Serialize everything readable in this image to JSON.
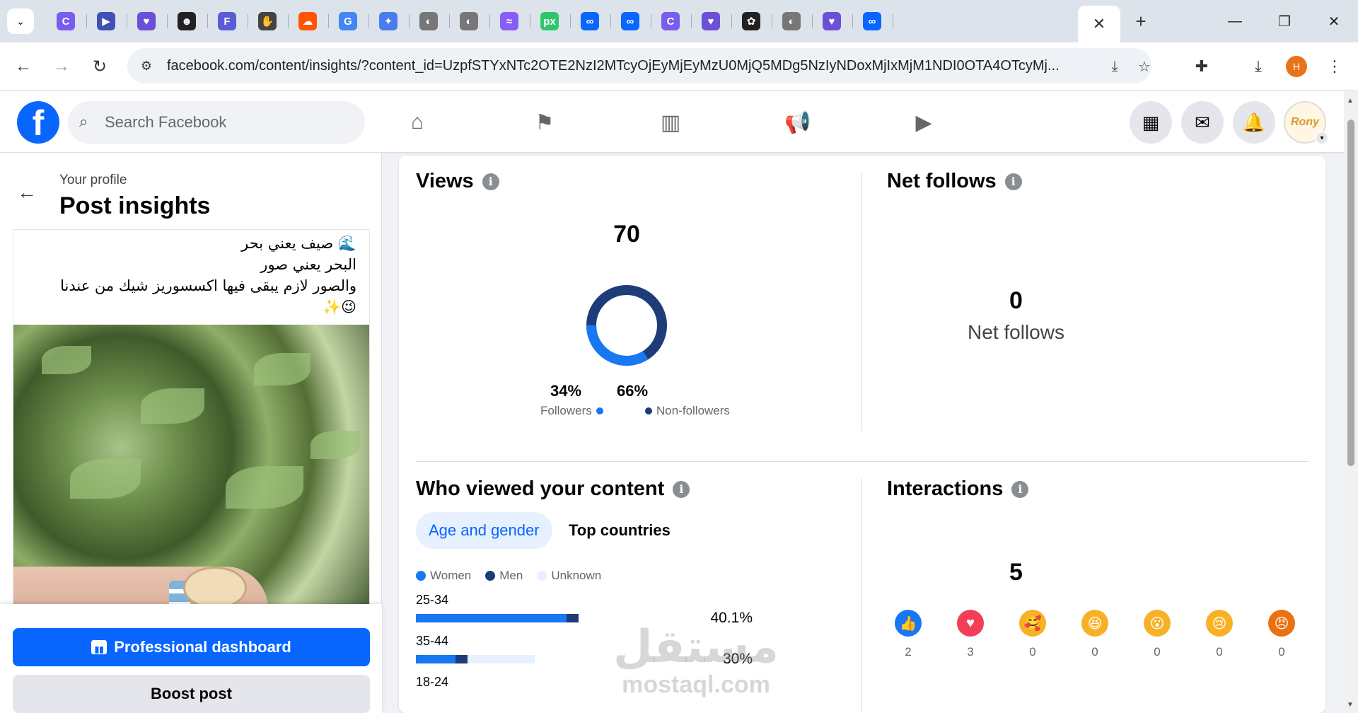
{
  "browser": {
    "tabs": [
      {
        "icon": "copilot-icon",
        "color": "#7a5cf0",
        "glyph": "C"
      },
      {
        "icon": "video-call-icon",
        "color": "#3f51b5",
        "glyph": "▶"
      },
      {
        "icon": "heart-badge-icon",
        "color": "#6b4fd8",
        "glyph": "♥"
      },
      {
        "icon": "robot-icon",
        "color": "#222222",
        "glyph": "☻"
      },
      {
        "icon": "forms-icon",
        "color": "#5b5bd6",
        "glyph": "F"
      },
      {
        "icon": "hand-icon",
        "color": "#444444",
        "glyph": "✋"
      },
      {
        "icon": "soundcloud-icon",
        "color": "#ff5500",
        "glyph": "☁"
      },
      {
        "icon": "google-icon",
        "color": "#4285f4",
        "glyph": "G"
      },
      {
        "icon": "gemini-icon",
        "color": "#4a7cf0",
        "glyph": "✦"
      },
      {
        "icon": "globe-icon",
        "color": "#777777",
        "glyph": "◐"
      },
      {
        "icon": "globe-icon",
        "color": "#777777",
        "glyph": "◐"
      },
      {
        "icon": "stripes-icon",
        "color": "#8a5cf6",
        "glyph": "≈"
      },
      {
        "icon": "pixabay-icon",
        "color": "#2ec66d",
        "glyph": "px"
      },
      {
        "icon": "meta-icon",
        "color": "#0866ff",
        "glyph": "∞"
      },
      {
        "icon": "meta-icon",
        "color": "#0866ff",
        "glyph": "∞"
      },
      {
        "icon": "copilot-icon",
        "color": "#7a5cf0",
        "glyph": "C"
      },
      {
        "icon": "heart-badge-icon",
        "color": "#6b4fd8",
        "glyph": "♥"
      },
      {
        "icon": "chatgpt-icon",
        "color": "#222222",
        "glyph": "✿"
      },
      {
        "icon": "globe-icon",
        "color": "#777777",
        "glyph": "◐"
      },
      {
        "icon": "heart-badge-icon",
        "color": "#6b4fd8",
        "glyph": "♥"
      },
      {
        "icon": "meta-icon",
        "color": "#0866ff",
        "glyph": "∞"
      }
    ],
    "active_tab_close": "✕",
    "new_tab": "+",
    "url": "facebook.com/content/insights/?content_id=UzpfSTYxNTc2OTE2NzI2MTcyOjEyMjEyMzU0MjQ5MDg5NzIyNDoxMjIxMjM1NDI0OTA4OTcyMj...",
    "profile_letter": "H"
  },
  "facebook": {
    "search_placeholder": "Search Facebook",
    "logo_letter": "f",
    "avatar_text": "Rony"
  },
  "left": {
    "breadcrumb": "Your profile",
    "title": "Post insights",
    "post_lines": [
      "🌊 صيف يعني بحر",
      "البحر يعني صور",
      "والصور لازم يبقى فيها اكسسوريز شيك من عندنا",
      "😉✨"
    ],
    "dashboard_button": "Professional dashboard",
    "boost_button": "Boost post"
  },
  "views": {
    "title": "Views",
    "total": "70",
    "followers_pct": "34%",
    "followers_label": "Followers",
    "non_followers_pct": "66%",
    "non_followers_label": "Non-followers",
    "followers_fraction": 0.34,
    "colors": {
      "followers": "#1877f2",
      "non_followers": "#1d3c78"
    }
  },
  "net_follows": {
    "title": "Net follows",
    "value": "0",
    "label": "Net follows"
  },
  "who_viewed": {
    "title": "Who viewed your content",
    "tabs": [
      "Age and gender",
      "Top countries"
    ],
    "legend": [
      {
        "label": "Women",
        "color": "#1877f2"
      },
      {
        "label": "Men",
        "color": "#1d3c78"
      },
      {
        "label": "Unknown",
        "color": "#e7f0fe"
      }
    ],
    "rows": [
      {
        "age": "25-34",
        "value": "40.1%",
        "women": 0.76,
        "men": 0.06,
        "unknown": 0.0
      },
      {
        "age": "35-44",
        "value": "30%",
        "women": 0.2,
        "men": 0.06,
        "unknown": 0.34
      },
      {
        "age": "18-24",
        "value": "",
        "women": 0,
        "men": 0,
        "unknown": 0
      }
    ]
  },
  "interactions": {
    "title": "Interactions",
    "total": "5",
    "reactions": [
      {
        "name": "like-reaction-icon",
        "glyph": "👍",
        "bg": "#1877f2",
        "count": "2"
      },
      {
        "name": "love-reaction-icon",
        "glyph": "♥",
        "bg": "#f33e58",
        "count": "3"
      },
      {
        "name": "care-reaction-icon",
        "glyph": "🥰",
        "bg": "#f7b125",
        "count": "0"
      },
      {
        "name": "haha-reaction-icon",
        "glyph": "😆",
        "bg": "#f7b125",
        "count": "0"
      },
      {
        "name": "wow-reaction-icon",
        "glyph": "😮",
        "bg": "#f7b125",
        "count": "0"
      },
      {
        "name": "sad-reaction-icon",
        "glyph": "😢",
        "bg": "#f7b125",
        "count": "0"
      },
      {
        "name": "angry-reaction-icon",
        "glyph": "😠",
        "bg": "#e9710f",
        "count": "0"
      }
    ]
  },
  "watermark": {
    "arabic": "مستقل",
    "latin": "mostaql.com"
  }
}
